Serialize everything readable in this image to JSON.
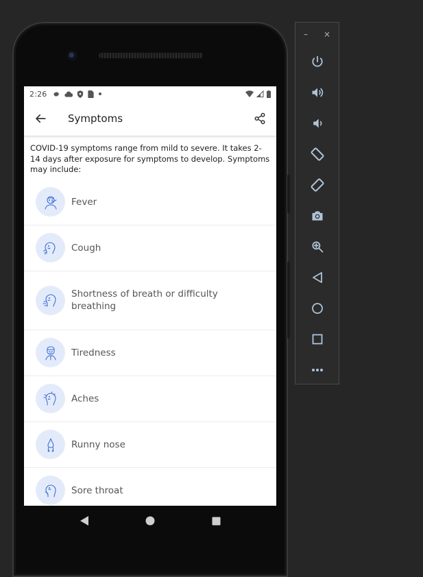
{
  "status_bar": {
    "time": "2:26",
    "left_icons": [
      "gear-icon",
      "cloud-icon",
      "shield-icon",
      "sim-card-icon",
      "dot-icon"
    ],
    "right_icons": [
      "wifi-icon",
      "signal-icon",
      "battery-icon"
    ]
  },
  "app_bar": {
    "back_icon": "arrow-left-icon",
    "title": "Symptoms",
    "share_icon": "share-icon"
  },
  "intro_text": "COVID-19 symptoms range from mild to severe. It takes 2-14 days after exposure for symptoms to develop. Symptoms may include:",
  "symptoms": [
    {
      "label": "Fever",
      "icon": "fever-icon"
    },
    {
      "label": "Cough",
      "icon": "cough-icon"
    },
    {
      "label": "Shortness of breath or difficulty breathing",
      "icon": "breath-icon"
    },
    {
      "label": "Tiredness",
      "icon": "tiredness-icon"
    },
    {
      "label": "Aches",
      "icon": "aches-icon"
    },
    {
      "label": "Runny nose",
      "icon": "runny-nose-icon"
    },
    {
      "label": "Sore throat",
      "icon": "sore-throat-icon"
    }
  ],
  "nav_bar": [
    "back-triangle-icon",
    "home-circle-icon",
    "recents-square-icon"
  ],
  "emulator_panel": {
    "minimize": "–",
    "close": "×",
    "tools": [
      "power-icon",
      "volume-up-icon",
      "volume-down-icon",
      "rotate-left-icon",
      "rotate-right-icon",
      "camera-icon",
      "zoom-icon",
      "back-icon",
      "home-icon",
      "overview-icon",
      "more-icon"
    ]
  },
  "colors": {
    "icon_circle_bg": "#e3ebfb",
    "icon_line": "#3d6fd6",
    "emulator_icon": "#aec3d8"
  }
}
